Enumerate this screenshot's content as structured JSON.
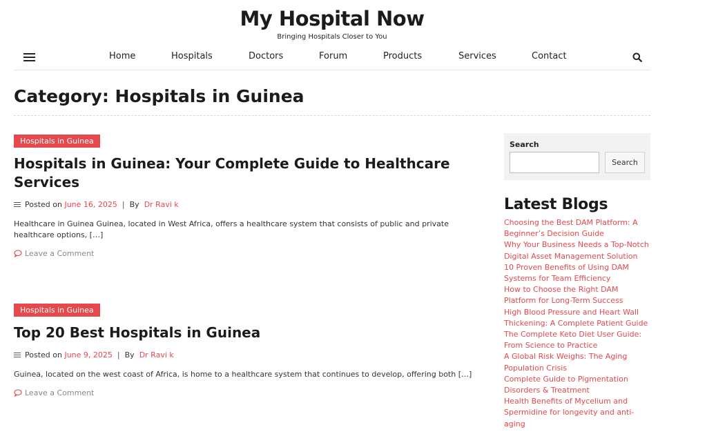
{
  "site": {
    "title": "My Hospital Now",
    "tagline": "Bringing Hospitals Closer to You"
  },
  "nav": {
    "items": [
      "Home",
      "Hospitals",
      "Doctors",
      "Forum",
      "Products",
      "Services",
      "Contact"
    ],
    "menu_icon": "hamburger-menu-icon",
    "search_icon": "search-icon"
  },
  "page": {
    "title": "Category: Hospitals in Guinea"
  },
  "posts": [
    {
      "category": "Hospitals in Guinea",
      "title": "Hospitals in Guinea: Your Complete Guide to Healthcare Services",
      "posted_on_label": "Posted on",
      "date": "June 16, 2025",
      "by_label": "By",
      "author": "Dr Ravi k",
      "excerpt": "Healthcare in Guinea Guinea, located in West Africa, offers a healthcare system that consists of public and private healthcare options, […]",
      "comment_link": "Leave a Comment"
    },
    {
      "category": "Hospitals in Guinea",
      "title": "Top 20 Best Hospitals in Guinea",
      "posted_on_label": "Posted on",
      "date": "June 9, 2025",
      "by_label": "By",
      "author": "Dr Ravi k",
      "excerpt": "Guinea, located on the west coast of Africa, is home to a healthcare system that continues to develop, offering both […]",
      "comment_link": "Leave a Comment"
    }
  ],
  "sidebar": {
    "search": {
      "label": "Search",
      "input_value": "",
      "button_label": "Search"
    },
    "latest_blogs": {
      "heading": "Latest Blogs",
      "items": [
        "Choosing the Best DAM Platform: A Beginner’s Decision Guide",
        "Why Your Business Needs a Top-Notch Digital Asset Management Solution",
        "10 Proven Benefits of Using DAM Systems for Team Efficiency",
        "How to Choose the Right DAM Platform for Long-Term Success",
        "High Blood Pressure and Heart Wall Thickening: A Complete Patient Guide",
        "The Complete Keto Diet User Guide: From Science to Practice",
        "A Global Risk Weighs: The Aging Population Crisis",
        "Complete Guide to Pigmentation Disorders & Treatment",
        "Health Benefits of Mycelium and Spermidine for longevity and anti-aging"
      ]
    }
  },
  "colors": {
    "accent": "#e5484d",
    "text": "#1b1b1b",
    "muted": "#888888",
    "widget_bg": "#f2f2f2"
  }
}
